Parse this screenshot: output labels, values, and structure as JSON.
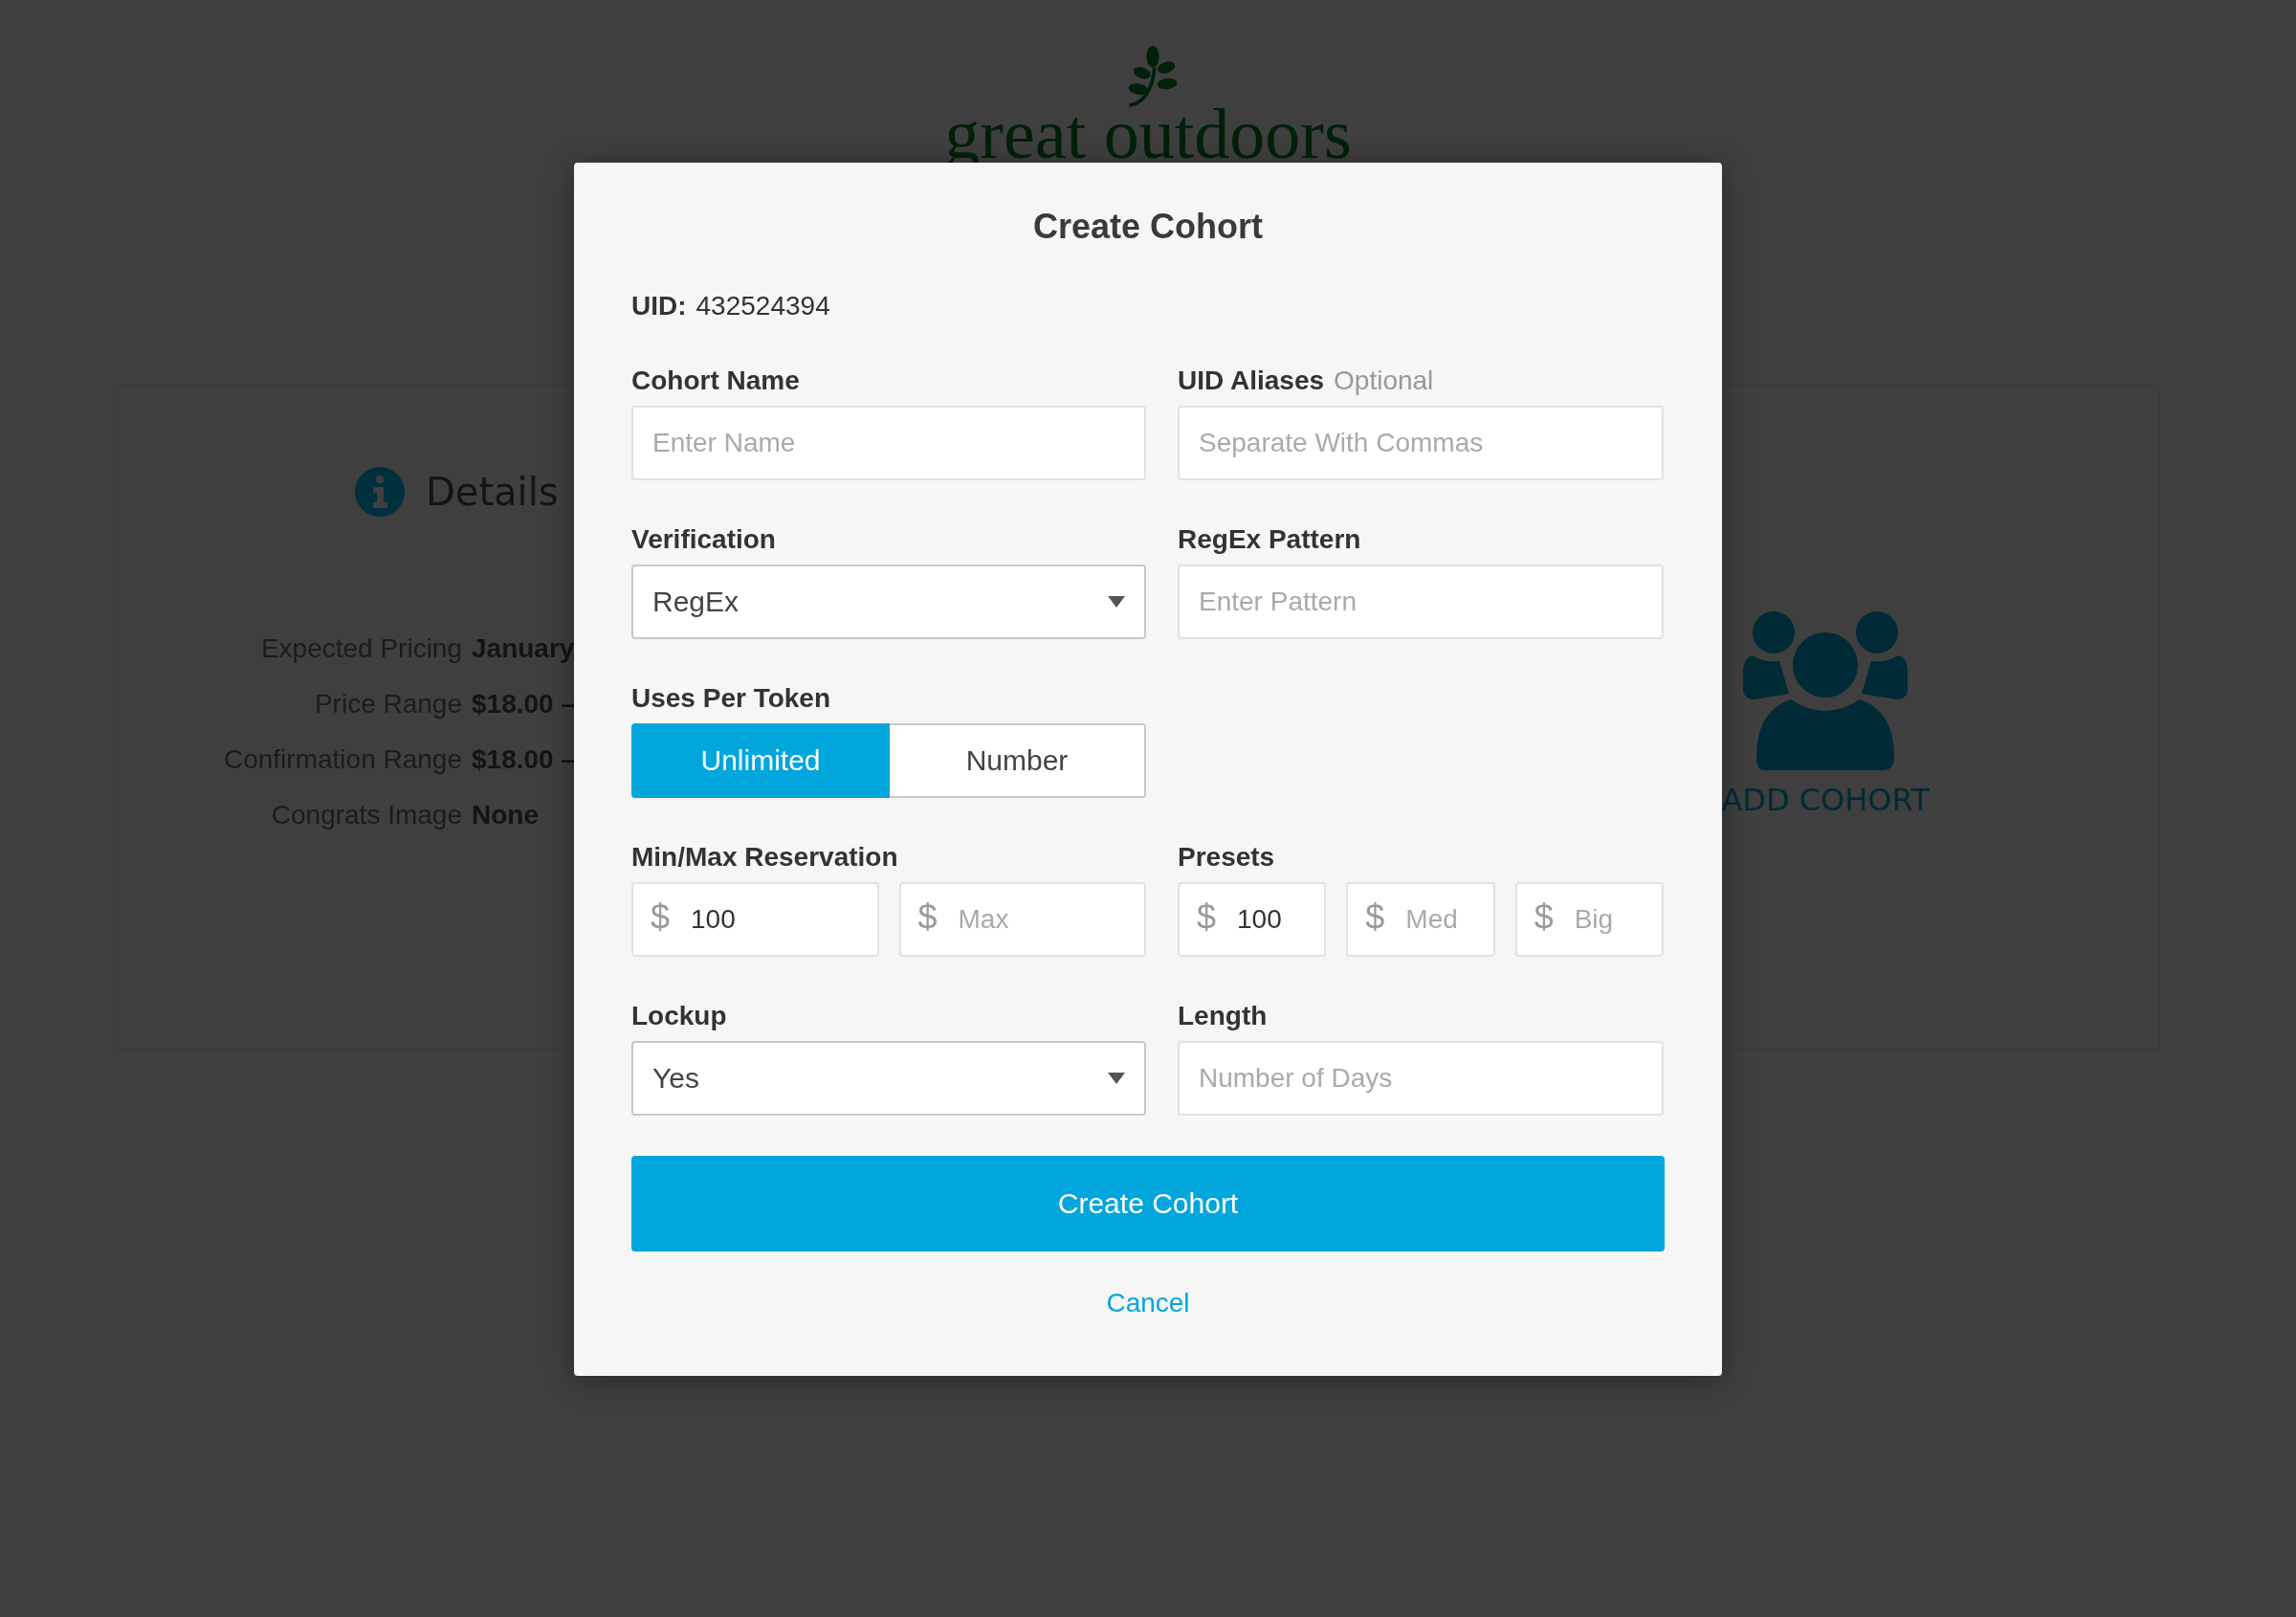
{
  "background": {
    "logo": {
      "text": "great outdoors"
    },
    "details": {
      "title": "Details",
      "rows": [
        {
          "label": "Expected Pricing",
          "value": "January"
        },
        {
          "label": "Price Range",
          "value": "$18.00 –"
        },
        {
          "label": "Confirmation Range",
          "value": "$18.00 –"
        },
        {
          "label": "Congrats Image",
          "value": "None"
        }
      ]
    },
    "add_cohort": {
      "label": "ADD COHORT"
    }
  },
  "modal": {
    "title": "Create Cohort",
    "uid": {
      "label": "UID:",
      "value": "432524394"
    },
    "rows": [
      {
        "fields": [
          {
            "kind": "text",
            "label": "Cohort Name",
            "placeholder": "Enter Name"
          },
          {
            "kind": "text",
            "label": "UID Aliases",
            "hint": "Optional",
            "placeholder": "Separate With Commas"
          }
        ]
      },
      {
        "fields": [
          {
            "kind": "select",
            "label": "Verification",
            "value": "RegEx"
          },
          {
            "kind": "text",
            "label": "RegEx Pattern",
            "placeholder": "Enter Pattern"
          }
        ]
      },
      {
        "fields": [
          {
            "kind": "segmented",
            "label": "Uses Per Token",
            "options": [
              {
                "label": "Unlimited",
                "selected": true
              },
              {
                "label": "Number",
                "selected": false
              }
            ]
          }
        ]
      },
      {
        "fields": [
          {
            "kind": "currency",
            "label": "Min/Max Reservation",
            "inputs": [
              {
                "prefix": "$",
                "value": "100"
              },
              {
                "prefix": "$",
                "placeholder": "Max"
              }
            ]
          },
          {
            "kind": "currency",
            "label": "Presets",
            "inputs": [
              {
                "prefix": "$",
                "value": "100"
              },
              {
                "prefix": "$",
                "placeholder": "Med"
              },
              {
                "prefix": "$",
                "placeholder": "Big"
              }
            ]
          }
        ]
      },
      {
        "fields": [
          {
            "kind": "select",
            "label": "Lockup",
            "value": "Yes"
          },
          {
            "kind": "text",
            "label": "Length",
            "placeholder": "Number of Days"
          }
        ]
      }
    ],
    "submit": "Create Cohort",
    "cancel": "Cancel"
  }
}
